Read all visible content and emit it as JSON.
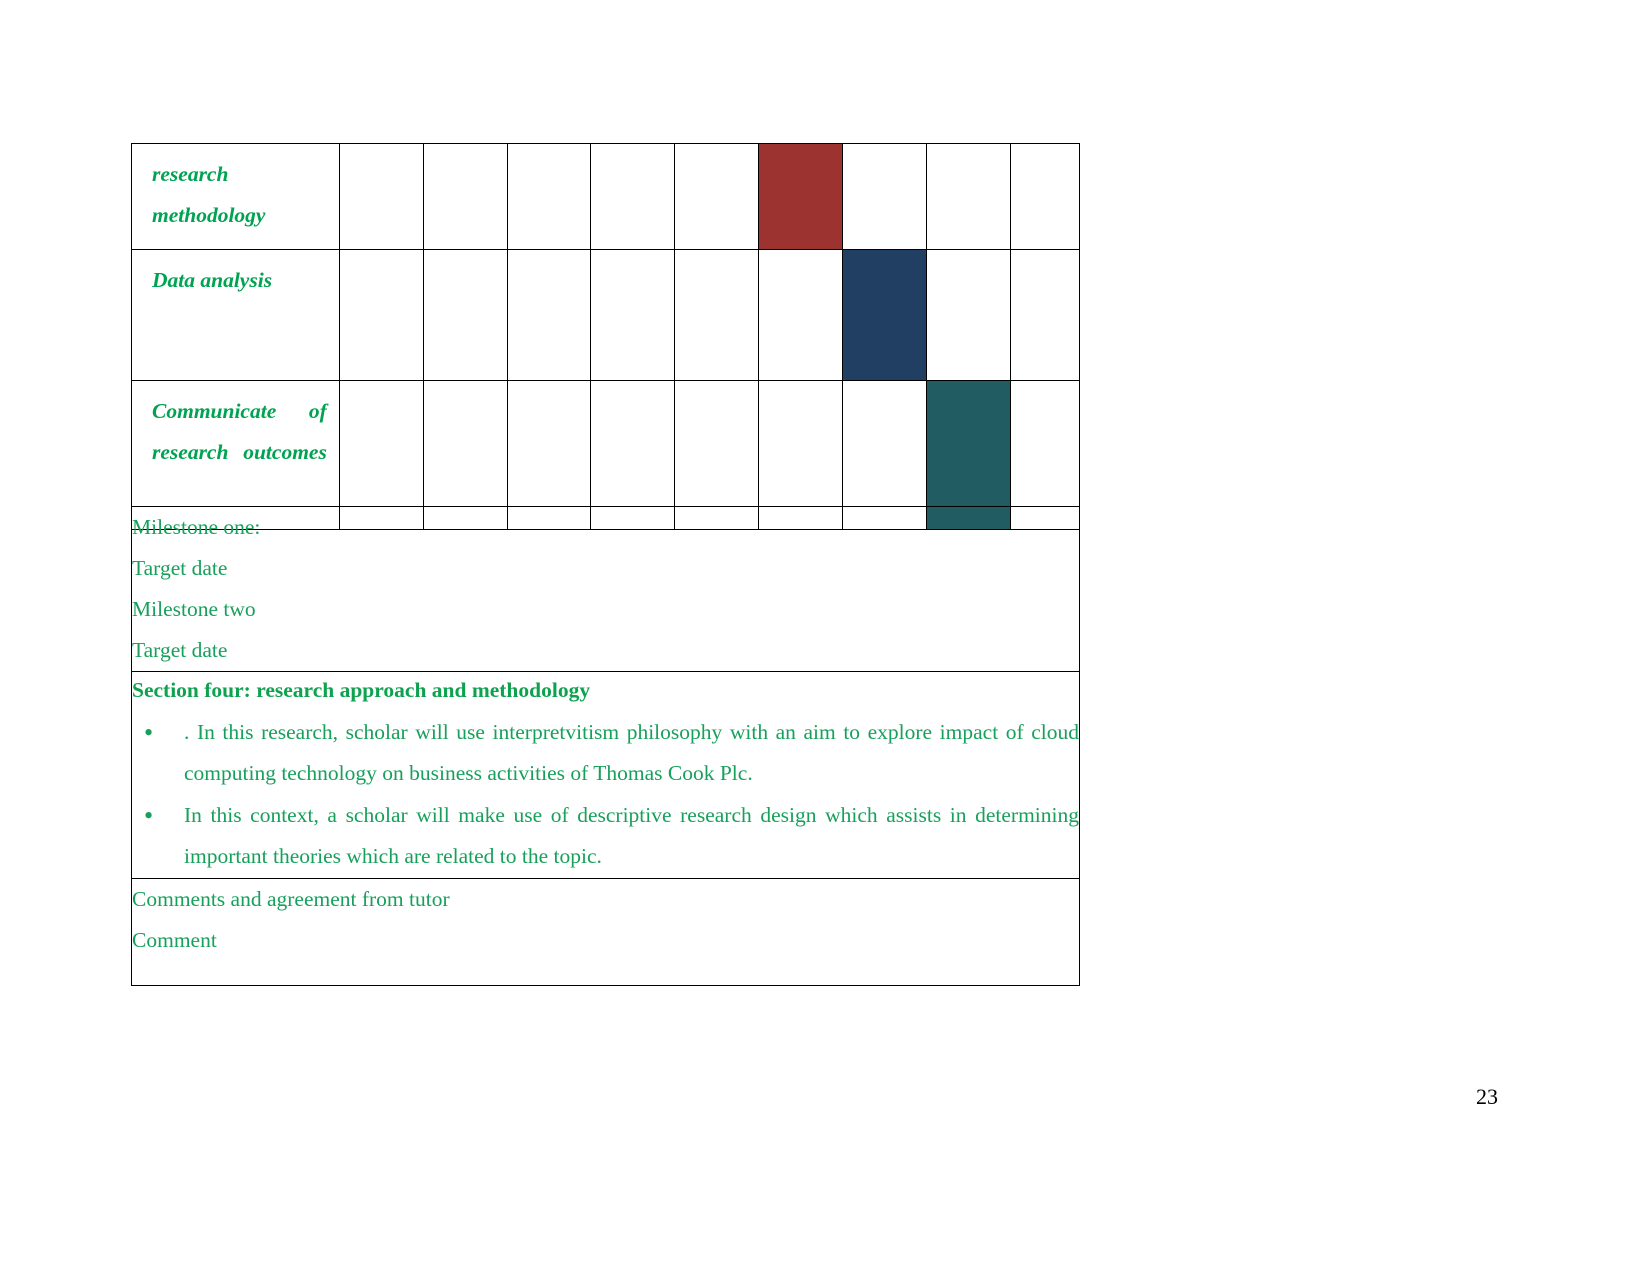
{
  "colors": {
    "green_text": "#17A05B",
    "heading_green": "#0EA24F",
    "bar_red": "#9C3330",
    "bar_navy": "#203F63",
    "bar_teal": "#225C63",
    "border": "#000000"
  },
  "gantt": {
    "rows": [
      {
        "task": "research methodology",
        "cells": [
          {
            "filled": false
          },
          {
            "filled": false
          },
          {
            "filled": false
          },
          {
            "filled": false
          },
          {
            "filled": false
          },
          {
            "filled": true,
            "color": "#9C3330"
          },
          {
            "filled": false
          },
          {
            "filled": false
          },
          {
            "filled": false
          }
        ]
      },
      {
        "task": "Data analysis",
        "cells": [
          {
            "filled": false
          },
          {
            "filled": false
          },
          {
            "filled": false
          },
          {
            "filled": false
          },
          {
            "filled": false
          },
          {
            "filled": false
          },
          {
            "filled": true,
            "color": "#203F63"
          },
          {
            "filled": false
          },
          {
            "filled": false
          }
        ]
      },
      {
        "task": "Communicate of research outcomes",
        "cells": [
          {
            "filled": false
          },
          {
            "filled": false
          },
          {
            "filled": false
          },
          {
            "filled": false
          },
          {
            "filled": false
          },
          {
            "filled": false
          },
          {
            "filled": false
          },
          {
            "filled": true,
            "color": "#225C63"
          },
          {
            "filled": false
          }
        ]
      }
    ]
  },
  "form": {
    "milestones": [
      "Milestone one:",
      "Target date",
      "Milestone two",
      "Target date"
    ],
    "section": {
      "heading": "Section four: research approach and methodology",
      "bullets": [
        ". In this research, scholar will use interpretvitism philosophy with an aim to explore impact of cloud computing technology on business activities of Thomas Cook Plc.",
        "In this context, a scholar will make use of descriptive research design which assists in determining important theories which are related to the topic."
      ],
      "bullet_glyph": "•"
    },
    "comments": [
      "Comments and agreement from tutor",
      "Comment"
    ]
  },
  "page_number": "23"
}
